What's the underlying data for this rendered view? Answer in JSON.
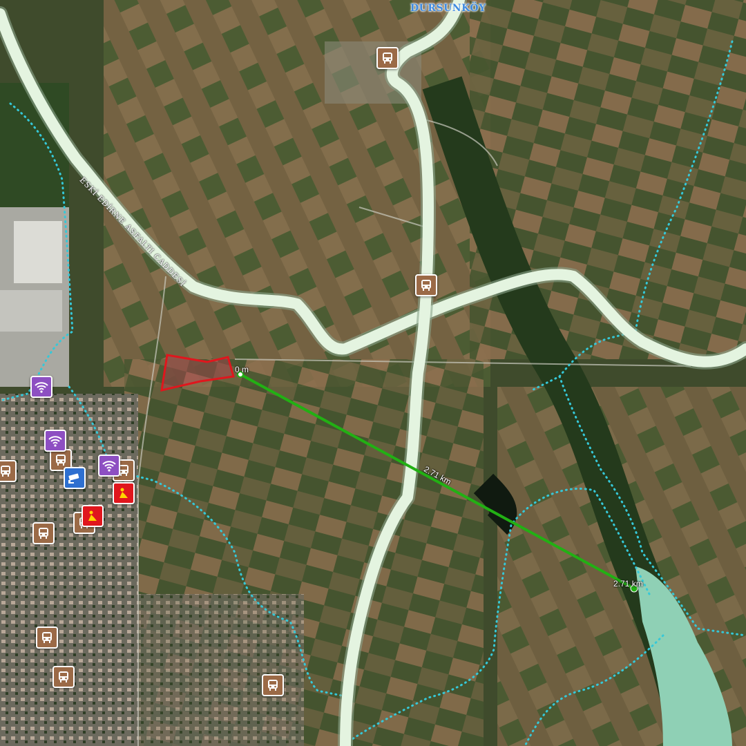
{
  "map": {
    "place_label": "DURSUNKÖY",
    "road_label": "ESKİ EDİRNE ASFALTI CADDESİ",
    "measure": {
      "start_label": "0 m",
      "mid_label": "2.71 km",
      "end_label": "2.71 km",
      "line_color": "#22b014"
    },
    "parcel_color": "#e0161d",
    "boundary_color": "#35c8d8",
    "road_color": "#e4f4e0",
    "poi": {
      "bus_icon": "bus-icon",
      "wifi_icon": "wifi-icon",
      "camera_icon": "camera-icon",
      "warning_icon": "worker-warning-icon"
    }
  }
}
